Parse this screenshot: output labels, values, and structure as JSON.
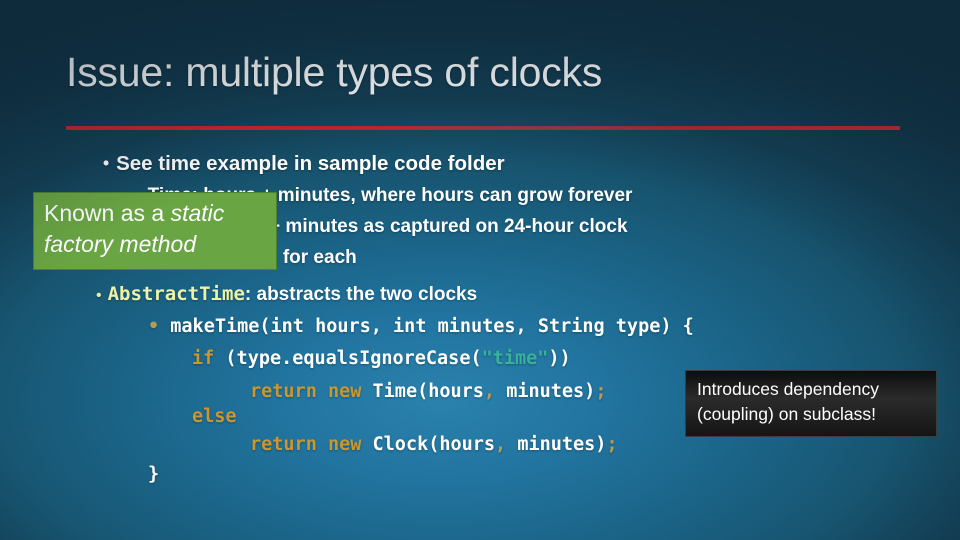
{
  "slide": {
    "title": "Issue: multiple types of clocks",
    "background_color": "#1b6488",
    "accent_rule_color": "#c9252d"
  },
  "bullets": {
    "level1": [
      {
        "marker": "•",
        "text": "See time example in sample code folder"
      }
    ],
    "level2": [
      {
        "marker": "•",
        "text": "Time: hours + minutes, where hours can grow forever"
      },
      {
        "marker": "•",
        "text": "Clock: hours + minutes as captured on 24-hour clock"
      },
      {
        "marker": "•",
        "text": "Separate code for each"
      }
    ]
  },
  "abstract_line": {
    "marker": "•",
    "code_name": "AbstractTime",
    "rest": ": abstracts the two clocks",
    "code_name_color": "#eef2a8"
  },
  "code": {
    "language": "java",
    "lines": [
      {
        "indent": 0,
        "tokens": [
          {
            "t": "• ",
            "c": "pun"
          },
          {
            "t": "makeTime(int hours, int minutes, String type) {",
            "c": "cls"
          }
        ]
      },
      {
        "indent": 1,
        "tokens": [
          {
            "t": "if",
            "c": "kw"
          },
          {
            "t": " (type.equalsIgnoreCase(",
            "c": "cls"
          },
          {
            "t": "\"time\"",
            "c": "str"
          },
          {
            "t": "))",
            "c": "cls"
          }
        ]
      },
      {
        "indent": 2,
        "tokens": [
          {
            "t": "return new",
            "c": "kw"
          },
          {
            "t": " Time(hours",
            "c": "cls"
          },
          {
            "t": ",",
            "c": "pun"
          },
          {
            "t": " minutes)",
            "c": "cls"
          },
          {
            "t": ";",
            "c": "pun"
          }
        ]
      },
      {
        "indent": 1,
        "tokens": [
          {
            "t": "else",
            "c": "kw"
          }
        ]
      },
      {
        "indent": 2,
        "tokens": [
          {
            "t": "return new",
            "c": "kw"
          },
          {
            "t": " Clock(hours",
            "c": "cls"
          },
          {
            "t": ",",
            "c": "pun"
          },
          {
            "t": " minutes)",
            "c": "cls"
          },
          {
            "t": ";",
            "c": "pun"
          }
        ]
      },
      {
        "indent": 0,
        "tokens": [
          {
            "t": "}",
            "c": "cls"
          }
        ]
      }
    ],
    "keyword_color": "#c9972f",
    "string_color": "#36b39a",
    "punctuation_color": "#b99a55"
  },
  "callout_green": {
    "line1_prefix": "Known as a ",
    "line1_emphasis": "static",
    "line2_emphasis": "factory method",
    "background_color": "#6aa543",
    "text_color": "#ffffff"
  },
  "callout_black": {
    "line1": "Introduces dependency",
    "line2": "(coupling) on subclass!",
    "background_color": "#1a1a1a",
    "text_color": "#ffffff"
  }
}
